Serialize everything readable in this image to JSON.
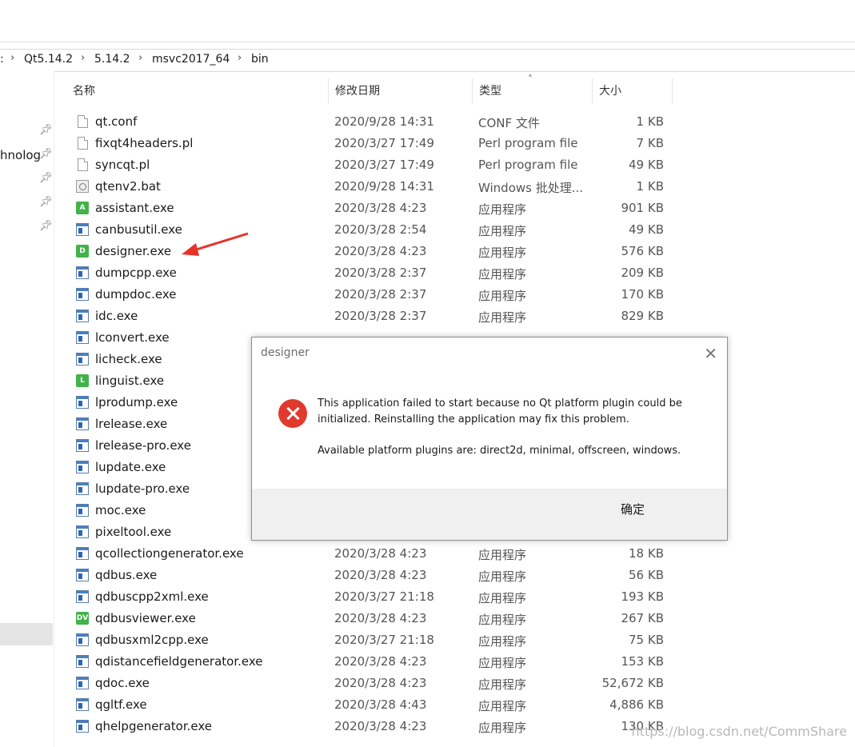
{
  "address_bar": {
    "crumbs": [
      ":",
      "Qt5.14.2",
      "5.14.2",
      "msvc2017_64",
      "bin"
    ]
  },
  "nav_pane": {
    "partial_label": "hnolog"
  },
  "columns": {
    "name": "名称",
    "date": "修改日期",
    "type": "类型",
    "size": "大小"
  },
  "files": [
    {
      "name": "qt.conf",
      "date": "2020/9/28 14:31",
      "type": "CONF 文件",
      "size": "1 KB",
      "icon": "document-icon"
    },
    {
      "name": "fixqt4headers.pl",
      "date": "2020/3/27 17:49",
      "type": "Perl program file",
      "size": "7 KB",
      "icon": "document-icon"
    },
    {
      "name": "syncqt.pl",
      "date": "2020/3/27 17:49",
      "type": "Perl program file",
      "size": "49 KB",
      "icon": "document-icon"
    },
    {
      "name": "qtenv2.bat",
      "date": "2020/9/28 14:31",
      "type": "Windows 批处理...",
      "size": "1 KB",
      "icon": "batch-file-icon"
    },
    {
      "name": "assistant.exe",
      "date": "2020/3/28 4:23",
      "type": "应用程序",
      "size": "901 KB",
      "icon": "green-app-icon",
      "badge": "A"
    },
    {
      "name": "canbusutil.exe",
      "date": "2020/3/28 2:54",
      "type": "应用程序",
      "size": "49 KB",
      "icon": "exe-icon"
    },
    {
      "name": "designer.exe",
      "date": "2020/3/28 4:23",
      "type": "应用程序",
      "size": "576 KB",
      "icon": "green-app-icon",
      "badge": "D"
    },
    {
      "name": "dumpcpp.exe",
      "date": "2020/3/28 2:37",
      "type": "应用程序",
      "size": "209 KB",
      "icon": "exe-icon"
    },
    {
      "name": "dumpdoc.exe",
      "date": "2020/3/28 2:37",
      "type": "应用程序",
      "size": "170 KB",
      "icon": "exe-icon"
    },
    {
      "name": "idc.exe",
      "date": "2020/3/28 2:37",
      "type": "应用程序",
      "size": "829 KB",
      "icon": "exe-icon"
    },
    {
      "name": "lconvert.exe",
      "date": "",
      "type": "",
      "size": "",
      "icon": "exe-icon"
    },
    {
      "name": "licheck.exe",
      "date": "",
      "type": "",
      "size": "",
      "icon": "exe-icon"
    },
    {
      "name": "linguist.exe",
      "date": "",
      "type": "",
      "size": "",
      "icon": "green-app-icon",
      "badge": "L"
    },
    {
      "name": "lprodump.exe",
      "date": "",
      "type": "",
      "size": "",
      "icon": "exe-icon"
    },
    {
      "name": "lrelease.exe",
      "date": "",
      "type": "",
      "size": "",
      "icon": "exe-icon"
    },
    {
      "name": "lrelease-pro.exe",
      "date": "",
      "type": "",
      "size": "",
      "icon": "exe-icon"
    },
    {
      "name": "lupdate.exe",
      "date": "",
      "type": "",
      "size": "",
      "icon": "exe-icon"
    },
    {
      "name": "lupdate-pro.exe",
      "date": "",
      "type": "",
      "size": "",
      "icon": "exe-icon"
    },
    {
      "name": "moc.exe",
      "date": "",
      "type": "",
      "size": "",
      "icon": "exe-icon"
    },
    {
      "name": "pixeltool.exe",
      "date": "",
      "type": "",
      "size": "",
      "icon": "exe-icon"
    },
    {
      "name": "qcollectiongenerator.exe",
      "date": "2020/3/28 4:23",
      "type": "应用程序",
      "size": "18 KB",
      "icon": "exe-icon"
    },
    {
      "name": "qdbus.exe",
      "date": "2020/3/28 4:23",
      "type": "应用程序",
      "size": "56 KB",
      "icon": "exe-icon"
    },
    {
      "name": "qdbuscpp2xml.exe",
      "date": "2020/3/27 21:18",
      "type": "应用程序",
      "size": "193 KB",
      "icon": "exe-icon"
    },
    {
      "name": "qdbusviewer.exe",
      "date": "2020/3/28 4:23",
      "type": "应用程序",
      "size": "267 KB",
      "icon": "green-app-icon",
      "badge": "DV"
    },
    {
      "name": "qdbusxml2cpp.exe",
      "date": "2020/3/27 21:18",
      "type": "应用程序",
      "size": "75 KB",
      "icon": "exe-icon"
    },
    {
      "name": "qdistancefieldgenerator.exe",
      "date": "2020/3/28 4:23",
      "type": "应用程序",
      "size": "153 KB",
      "icon": "exe-icon"
    },
    {
      "name": "qdoc.exe",
      "date": "2020/3/28 4:23",
      "type": "应用程序",
      "size": "52,672 KB",
      "icon": "exe-icon"
    },
    {
      "name": "qgltf.exe",
      "date": "2020/3/28 4:43",
      "type": "应用程序",
      "size": "4,886 KB",
      "icon": "exe-icon"
    },
    {
      "name": "qhelpgenerator.exe",
      "date": "2020/3/28 4:23",
      "type": "应用程序",
      "size": "130 KB",
      "icon": "exe-icon"
    }
  ],
  "dialog": {
    "title": "designer",
    "message_line1": "This application failed to start because no Qt platform plugin could be",
    "message_line2": "initialized. Reinstalling the application may fix this problem.",
    "message_plugins": "Available platform plugins are: direct2d, minimal, offscreen, windows.",
    "ok_label": "确定",
    "close_glyph": "✕"
  },
  "watermark": "https://blog.csdn.net/CommShare",
  "colors": {
    "error_red": "#e03a2e",
    "annotation_arrow": "#e8332a",
    "button_focus": "#0078d7"
  }
}
